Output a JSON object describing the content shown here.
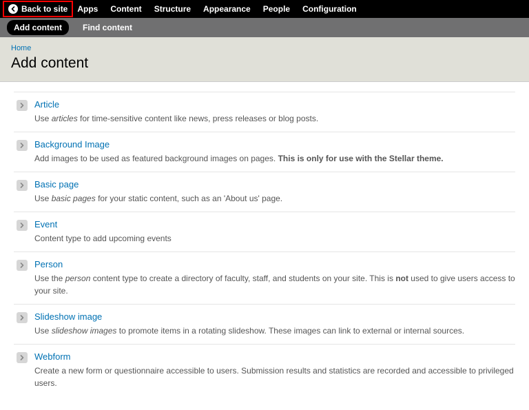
{
  "adminBar": {
    "backToSite": "Back to site",
    "menu": [
      "Apps",
      "Content",
      "Structure",
      "Appearance",
      "People",
      "Configuration"
    ]
  },
  "secondary": {
    "tabs": [
      {
        "label": "Add content",
        "active": true
      },
      {
        "label": "Find content",
        "active": false
      }
    ]
  },
  "breadcrumb": "Home",
  "pageTitle": "Add content",
  "contentTypes": [
    {
      "title": "Article",
      "desc_html": "Use <em>articles</em> for time-sensitive content like news, press releases or blog posts."
    },
    {
      "title": "Background Image",
      "desc_html": "Add images to be used as featured background images on pages. <strong>This is only for use with the Stellar theme.</strong>"
    },
    {
      "title": "Basic page",
      "desc_html": "Use <em>basic pages</em> for your static content, such as an 'About us' page."
    },
    {
      "title": "Event",
      "desc_html": "Content type to add upcoming events"
    },
    {
      "title": "Person",
      "desc_html": "Use the <em>person</em> content type to create a directory of faculty, staff, and students on your site. This is <strong>not</strong> used to give users access to your site."
    },
    {
      "title": "Slideshow image",
      "desc_html": "Use <em>slideshow images</em> to promote items in a rotating slideshow. These images can link to external or internal sources."
    },
    {
      "title": "Webform",
      "desc_html": "Create a new form or questionnaire accessible to users. Submission results and statistics are recorded and accessible to privileged users."
    }
  ]
}
